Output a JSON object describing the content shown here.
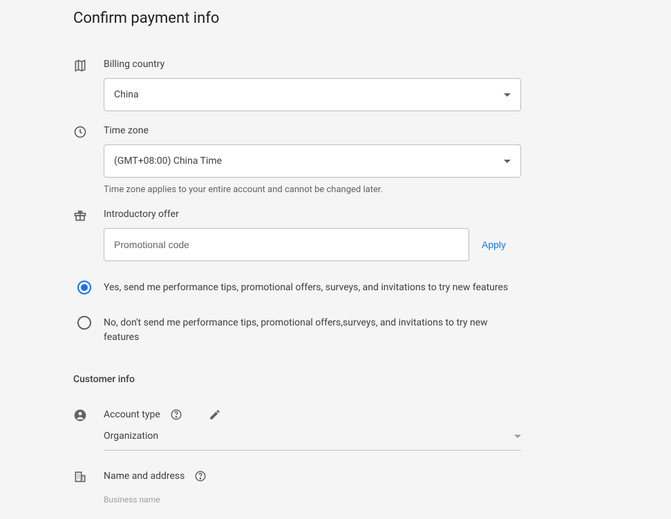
{
  "title": "Confirm payment info",
  "billingCountry": {
    "label": "Billing country",
    "value": "China"
  },
  "timezone": {
    "label": "Time zone",
    "value": "(GMT+08:00) China Time",
    "helper": "Time zone applies to your entire account and cannot be changed later."
  },
  "offer": {
    "label": "Introductory offer",
    "placeholder": "Promotional code",
    "apply": "Apply"
  },
  "tips": {
    "yesLabel": "Yes, send me performance tips, promotional offers, surveys, and invitations to try new features",
    "noLabel": "No, don't send me performance tips, promotional offers,surveys, and invitations to try new features"
  },
  "customer": {
    "heading": "Customer info",
    "accountTypeLabel": "Account type",
    "accountTypeValue": "Organization",
    "nameAddressLabel": "Name and address",
    "businessNameLabel": "Business name"
  }
}
